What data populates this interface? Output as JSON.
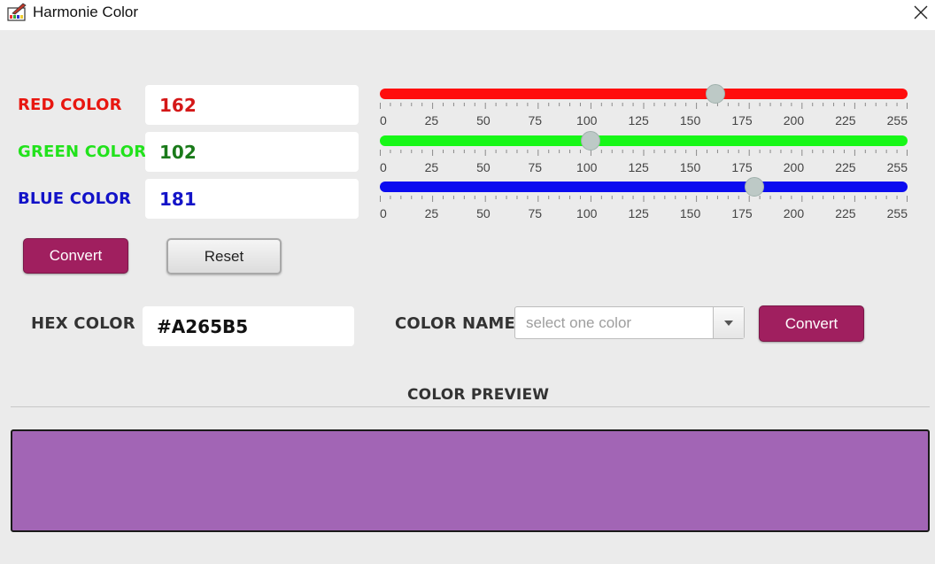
{
  "window": {
    "title": "Harmonie Color",
    "app_icon": "palette-icon",
    "close_icon": "close-icon"
  },
  "rgb": {
    "red": {
      "label": "RED COLOR",
      "value": "162",
      "label_color": "#e8160f",
      "value_color": "#d41818",
      "track_color": "#ff0d0d",
      "slider_value": 162
    },
    "green": {
      "label": "GREEN COLOR",
      "value": "102",
      "label_color": "#22e21c",
      "value_color": "#1a7a1a",
      "track_color": "#17f717",
      "slider_value": 102
    },
    "blue": {
      "label": "BLUE COLOR",
      "value": "181",
      "label_color": "#1212c8",
      "value_color": "#1414c8",
      "track_color": "#0b0bf0",
      "slider_value": 181
    }
  },
  "slider": {
    "min": 0,
    "max": 255,
    "major_ticks": [
      "0",
      "25",
      "50",
      "75",
      "100",
      "125",
      "150",
      "175",
      "200",
      "225",
      "255"
    ]
  },
  "buttons": {
    "convert_rgb": "Convert",
    "reset": "Reset",
    "convert_name": "Convert"
  },
  "hex": {
    "label": "HEX COLOR",
    "value": "#A265B5"
  },
  "color_name": {
    "label": "COLOR NAME",
    "placeholder": "select one color"
  },
  "preview": {
    "label": "COLOR PREVIEW",
    "color": "#a265b5"
  },
  "colors": {
    "accent": "#a01f5f",
    "background": "#ebebeb"
  }
}
